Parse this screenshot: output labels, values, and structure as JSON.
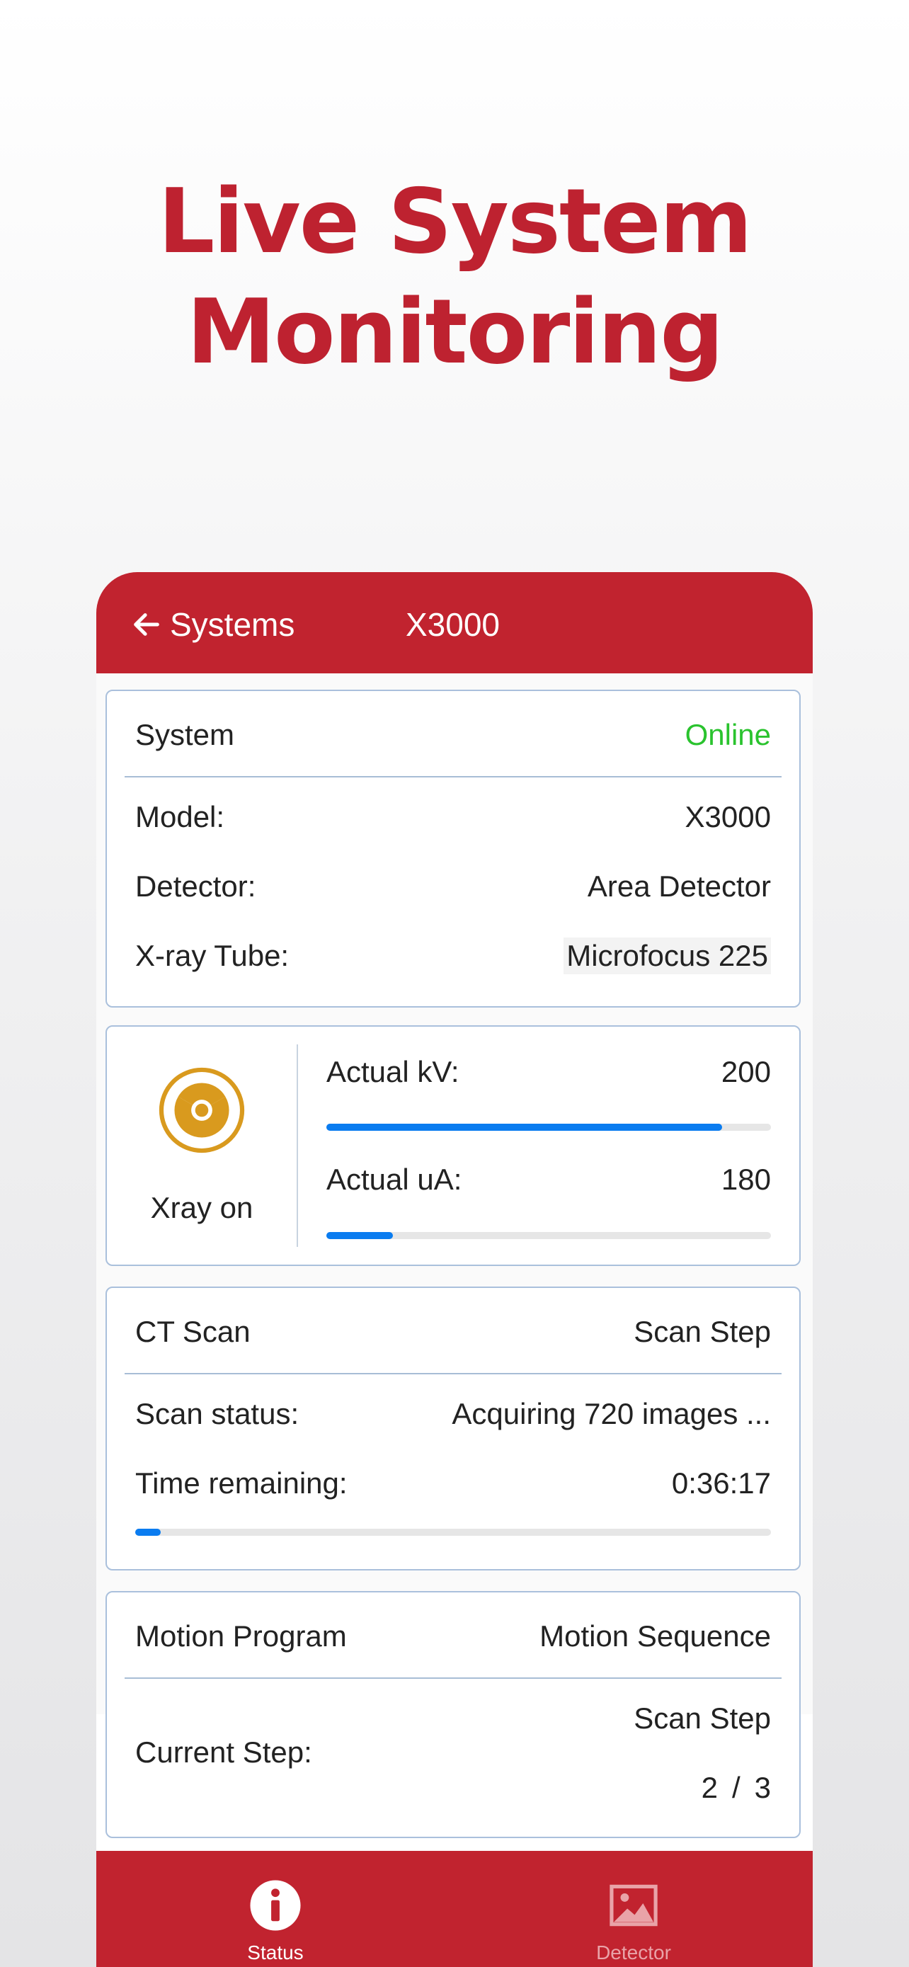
{
  "hero": {
    "line1": "Live System",
    "line2": "Monitoring"
  },
  "nav": {
    "back_label": "Systems",
    "title": "X3000"
  },
  "system_card": {
    "header_label": "System",
    "status": "Online",
    "rows": [
      {
        "label": "Model:",
        "value": "X3000"
      },
      {
        "label": "Detector:",
        "value": "Area Detector"
      },
      {
        "label": "X-ray Tube:",
        "value": "Microfocus 225"
      }
    ]
  },
  "xray_card": {
    "status_label": "Xray on",
    "kv_label": "Actual kV:",
    "kv_value": "200",
    "kv_level": 0.89,
    "ua_label": "Actual uA:",
    "ua_value": "180",
    "ua_level": 0.15
  },
  "ct_card": {
    "header_label": "CT Scan",
    "header_value": "Scan Step",
    "status_label": "Scan status:",
    "status_value": "Acquiring 720 images ...",
    "time_label": "Time remaining:",
    "time_value": "0:36:17",
    "progress": 0.04
  },
  "motion_card": {
    "header_label": "Motion Program",
    "header_value": "Motion Sequence",
    "step_label": "Current Step:",
    "step_name": "Scan Step",
    "step_current": "2",
    "step_sep": "/",
    "step_total": "3"
  },
  "tabs": [
    {
      "label": "Status",
      "icon": "info-icon",
      "active": true
    },
    {
      "label": "Detector",
      "icon": "image-icon",
      "active": false
    }
  ],
  "colors": {
    "brand": "#c1232f",
    "online": "#2ac32e",
    "progress": "#0a7cf0",
    "radiation": "#d99a1e"
  }
}
